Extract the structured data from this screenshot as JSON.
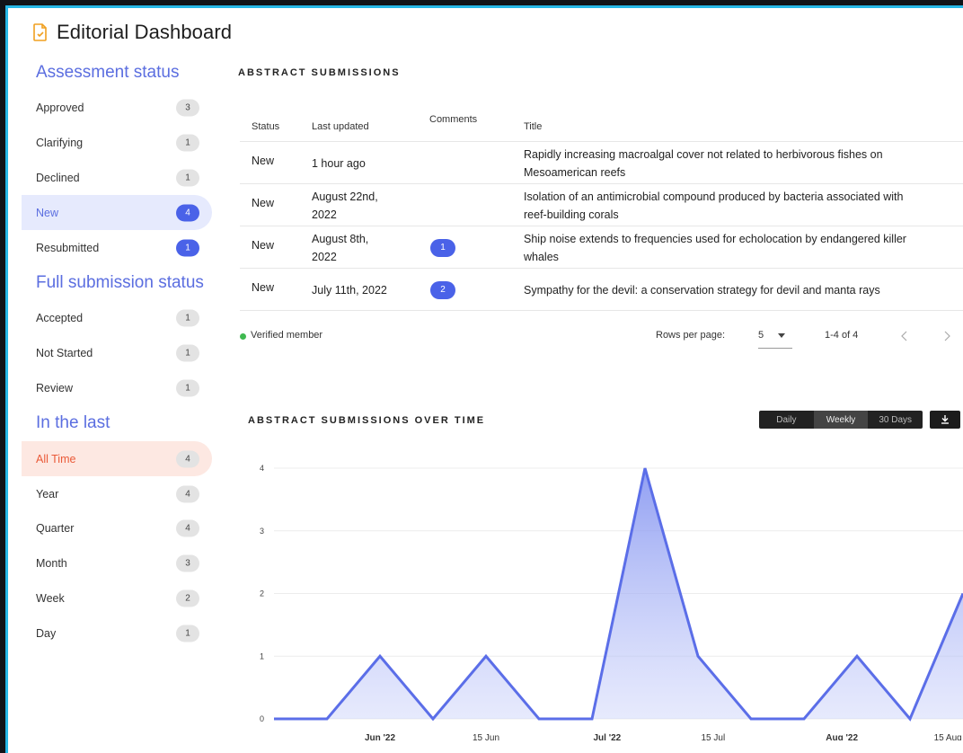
{
  "app": {
    "title": "Editorial Dashboard"
  },
  "sidebar": {
    "assessment": {
      "title": "Assessment status",
      "items": [
        {
          "label": "Approved",
          "count": "3",
          "state": "normal"
        },
        {
          "label": "Clarifying",
          "count": "1",
          "state": "normal"
        },
        {
          "label": "Declined",
          "count": "1",
          "state": "normal"
        },
        {
          "label": "New",
          "count": "4",
          "state": "selected"
        },
        {
          "label": "Resubmitted",
          "count": "1",
          "state": "highlight"
        }
      ]
    },
    "full": {
      "title": "Full submission status",
      "items": [
        {
          "label": "Accepted",
          "count": "1"
        },
        {
          "label": "Not Started",
          "count": "1"
        },
        {
          "label": "Review",
          "count": "1"
        }
      ]
    },
    "last": {
      "title": "In the last",
      "items": [
        {
          "label": "All Time",
          "count": "4",
          "state": "selected"
        },
        {
          "label": "Year",
          "count": "4"
        },
        {
          "label": "Quarter",
          "count": "4"
        },
        {
          "label": "Month",
          "count": "3"
        },
        {
          "label": "Week",
          "count": "2"
        },
        {
          "label": "Day",
          "count": "1"
        }
      ]
    }
  },
  "table": {
    "title": "ABSTRACT SUBMISSIONS",
    "headers": {
      "status": "Status",
      "updated": "Last updated",
      "comments": "Comments",
      "title": "Title"
    },
    "rows": [
      {
        "status": "New",
        "updated": [
          "1 hour ago"
        ],
        "comments": "",
        "title": [
          "Rapidly increasing macroalgal cover not related to herbivorous fishes on",
          "Mesoamerican reefs"
        ]
      },
      {
        "status": "New",
        "updated": [
          "August 22nd,",
          "2022"
        ],
        "comments": "",
        "title": [
          "Isolation of an antimicrobial compound produced by bacteria associated with",
          "reef-building corals"
        ]
      },
      {
        "status": "New",
        "updated": [
          "August 8th,",
          "2022"
        ],
        "comments": "1",
        "title": [
          "Ship noise extends to frequencies used for echolocation by endangered killer",
          "whales"
        ]
      },
      {
        "status": "New",
        "updated": [
          "July 11th, 2022"
        ],
        "comments": "2",
        "title": [
          "Sympathy for the devil: a conservation strategy for devil and manta rays"
        ]
      }
    ],
    "footer": {
      "legend": "Verified member",
      "rows_per_page_label": "Rows per page:",
      "rows_per_page": "5",
      "range": "1-4 of 4"
    }
  },
  "chart": {
    "title": "ABSTRACT SUBMISSIONS OVER TIME",
    "ranges": [
      "Daily",
      "Weekly",
      "30 Days"
    ],
    "selected_range": "Weekly"
  },
  "chart_data": {
    "type": "area",
    "x": [
      "2022-05-18",
      "2022-05-25",
      "2022-06-01",
      "2022-06-08",
      "2022-06-15",
      "2022-06-22",
      "2022-06-29",
      "2022-07-06",
      "2022-07-13",
      "2022-07-20",
      "2022-07-27",
      "2022-08-03",
      "2022-08-10",
      "2022-08-17"
    ],
    "values": [
      0,
      0,
      1,
      0,
      1,
      0,
      0,
      4,
      1,
      0,
      0,
      1,
      0,
      2
    ],
    "x_ticks": [
      {
        "label": "Jun '22",
        "at": "2022-06-01"
      },
      {
        "label": "15 Jun",
        "at": "2022-06-15"
      },
      {
        "label": "Jul '22",
        "at": "2022-07-01"
      },
      {
        "label": "15 Jul",
        "at": "2022-07-15"
      },
      {
        "label": "Aug '22",
        "at": "2022-08-01"
      },
      {
        "label": "15 Aug",
        "at": "2022-08-15"
      }
    ],
    "y_ticks": [
      0,
      1,
      2,
      3,
      4
    ],
    "ylim": [
      0,
      4
    ],
    "grid": true,
    "line_color": "#5b6ee8",
    "fill_color": "#c9d0fa"
  }
}
